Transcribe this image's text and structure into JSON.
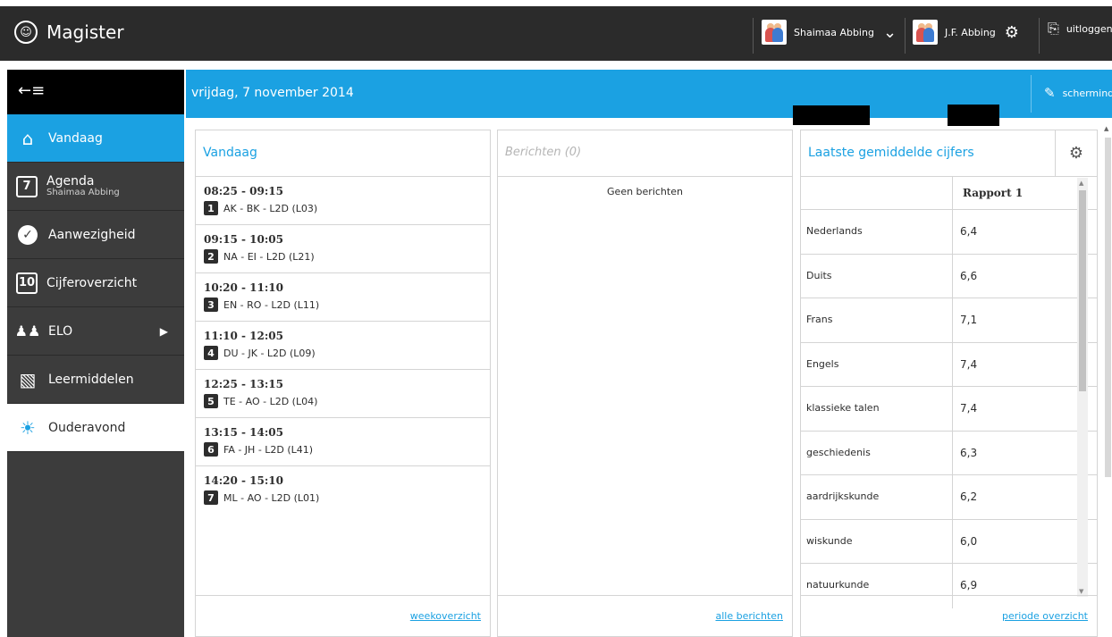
{
  "app": {
    "title": "Magister"
  },
  "topbar": {
    "user1": {
      "name": "Shaimaa Abbing"
    },
    "user2": {
      "name": "J.F. Abbing"
    },
    "logout_label": "uitloggen"
  },
  "sidebar": {
    "items": [
      {
        "label": "Vandaag",
        "icon": "home-icon"
      },
      {
        "label": "Agenda",
        "sublabel": "Shaimaa Abbing",
        "icon": "calendar-icon",
        "icon_text": "7"
      },
      {
        "label": "Aanwezigheid",
        "icon": "check-circle-icon"
      },
      {
        "label": "Cijferoverzicht",
        "icon": "grades-icon",
        "icon_text": "10"
      },
      {
        "label": "ELO",
        "icon": "group-icon"
      },
      {
        "label": "Leermiddelen",
        "icon": "books-icon"
      },
      {
        "label": "Ouderavond",
        "icon": "bulb-icon"
      }
    ]
  },
  "datebar": {
    "date": "vrijdag, 7 november 2014",
    "layout_label": "schermindeling"
  },
  "today": {
    "title": "Vandaag",
    "lessons": [
      {
        "time": "08:25 - 09:15",
        "hour": "1",
        "desc": "AK - BK - L2D (L03)"
      },
      {
        "time": "09:15 - 10:05",
        "hour": "2",
        "desc": "NA - EI - L2D (L21)"
      },
      {
        "time": "10:20 - 11:10",
        "hour": "3",
        "desc": "EN - RO - L2D (L11)"
      },
      {
        "time": "11:10 - 12:05",
        "hour": "4",
        "desc": "DU - JK - L2D (L09)"
      },
      {
        "time": "12:25 - 13:15",
        "hour": "5",
        "desc": "TE - AO - L2D (L04)"
      },
      {
        "time": "13:15 - 14:05",
        "hour": "6",
        "desc": "FA - JH - L2D (L41)"
      },
      {
        "time": "14:20 - 15:10",
        "hour": "7",
        "desc": "ML - AO - L2D (L01)"
      }
    ],
    "footer_link": "weekoverzicht"
  },
  "messages": {
    "title": "Berichten (0)",
    "empty": "Geen berichten",
    "footer_link": "alle berichten"
  },
  "grades": {
    "title": "Laatste gemiddelde cijfers",
    "column_header": "Rapport 1",
    "rows": [
      {
        "subject": "Nederlands",
        "value": "6,4"
      },
      {
        "subject": "Duits",
        "value": "6,6"
      },
      {
        "subject": "Frans",
        "value": "7,1"
      },
      {
        "subject": "Engels",
        "value": "7,4"
      },
      {
        "subject": "klassieke talen",
        "value": "7,4"
      },
      {
        "subject": "geschiedenis",
        "value": "6,3"
      },
      {
        "subject": "aardrijkskunde",
        "value": "6,2"
      },
      {
        "subject": "wiskunde",
        "value": "6,0"
      },
      {
        "subject": "natuurkunde",
        "value": "6,9"
      }
    ],
    "footer_link": "periode overzicht"
  },
  "colors": {
    "accent": "#1ba1e2",
    "sidebar": "#3c3c3c",
    "topbar": "#2b2b2b"
  }
}
